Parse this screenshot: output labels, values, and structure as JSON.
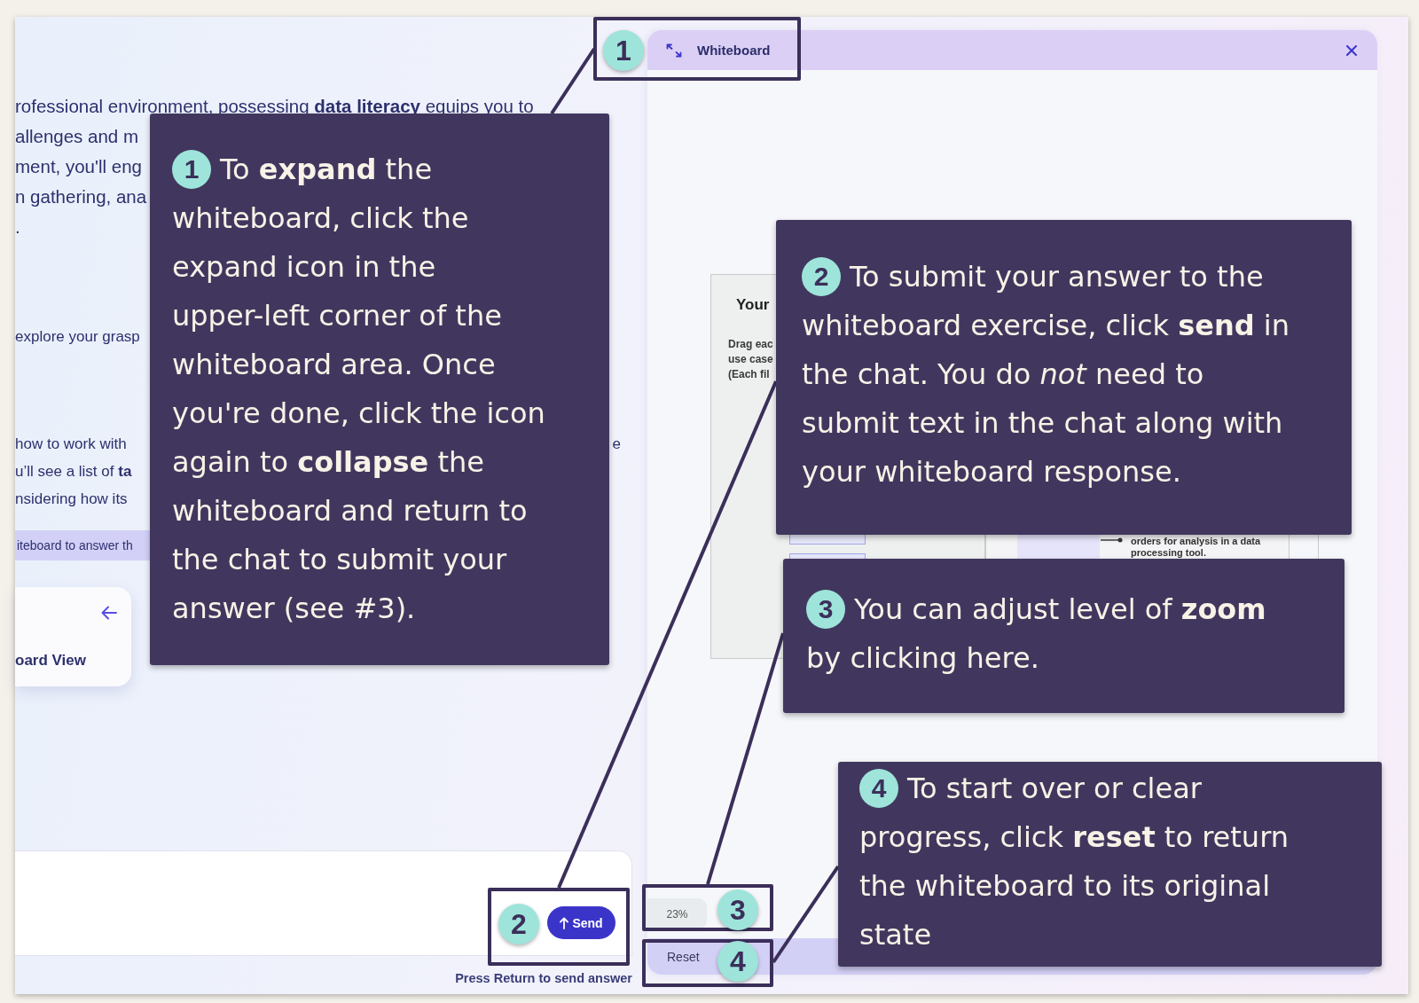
{
  "lesson_panel": {
    "paragraphs": [
      {
        "kind": "body",
        "lines": [
          {
            "text": "rofessional environment, possessing **data literacy** equips you to"
          },
          {
            "text": "allenges and m"
          },
          {
            "text": "ment, you'll eng"
          },
          {
            "text": "n gathering, ana"
          },
          {
            "text": "."
          }
        ]
      },
      {
        "kind": "small",
        "lines": [
          {
            "text": "explore your grasp"
          }
        ]
      },
      {
        "kind": "small",
        "lines": [
          {
            "text": "how to work with",
            "end_text": "e"
          },
          {
            "text": "u’ll see a list of **ta**"
          },
          {
            "text": "nsidering how its"
          }
        ]
      }
    ],
    "highlighted_prompt": "iteboard to answer th",
    "view_card": {
      "label": "oard View"
    }
  },
  "chat": {
    "send_button": "Send",
    "hint": "Press **Return** to send answer"
  },
  "whiteboard": {
    "title": "Whiteboard",
    "card": {
      "title": "Your",
      "instructions": [
        "Drag eac",
        "use case",
        "(Each fil"
      ]
    },
    "task_text": "orders for analysis in a data processing tool.",
    "zoom_level": "23%",
    "reset_button": "Reset"
  },
  "annotations": {
    "markers": [
      {
        "number": "1"
      },
      {
        "number": "2"
      },
      {
        "number": "3"
      },
      {
        "number": "4"
      }
    ],
    "callouts": [
      {
        "number": "1",
        "text": "To **expand** the whiteboard, click the expand icon in the upper-left corner of the whiteboard area. Once you're done, click the icon again to **collapse** the whiteboard and return to the chat to submit your answer (see #3)."
      },
      {
        "number": "2",
        "text": "To submit your answer to the whiteboard exercise, click **send** in the chat. You do *not* need to submit text in the chat along with your whiteboard response."
      },
      {
        "number": "3",
        "text": "You can adjust level of **zoom** by clicking here."
      },
      {
        "number": "4",
        "text": "To start over or clear progress, click **reset** to return the whiteboard to its original state"
      }
    ]
  }
}
